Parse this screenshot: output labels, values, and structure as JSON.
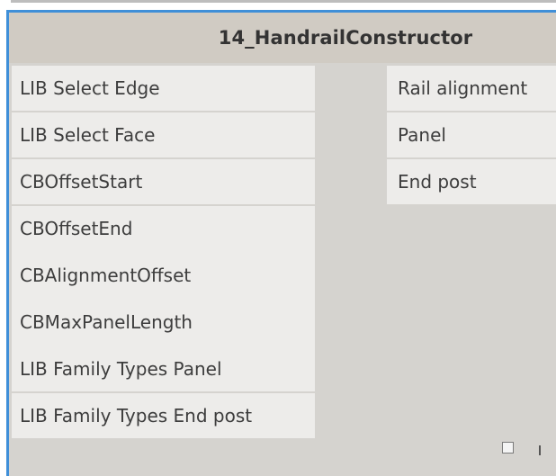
{
  "node": {
    "title": "14_HandrailConstructor",
    "inputs": [
      "LIB Select Edge",
      "LIB Select Face",
      "CBOffsetStart",
      "CBOffsetEnd",
      "CBAlignmentOffset",
      "CBMaxPanelLength",
      "LIB Family Types Panel",
      "LIB Family Types End post"
    ],
    "outputs": [
      "Rail alignment",
      "Panel",
      "End post"
    ]
  },
  "colors": {
    "selection_border": "#3f8fd8",
    "node_body": "#d5d3cf",
    "header": "#d0cbc3",
    "port": "#edecea"
  }
}
